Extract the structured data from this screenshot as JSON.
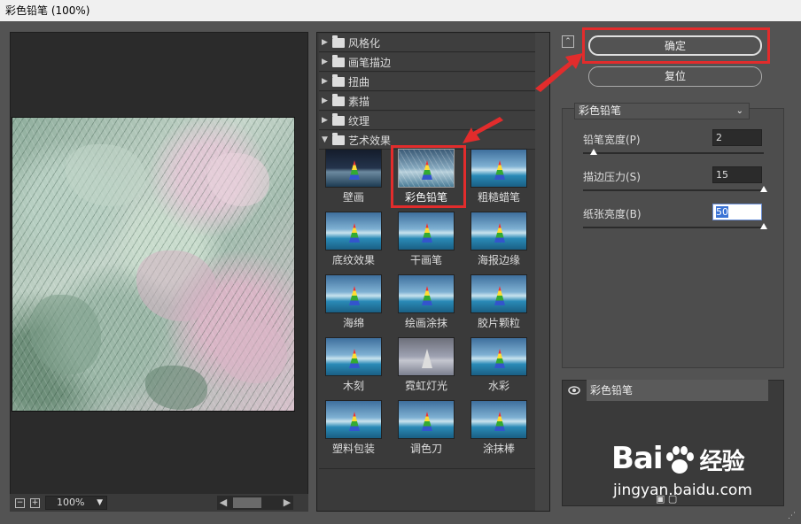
{
  "window": {
    "title": "彩色铅笔 (100%)"
  },
  "preview": {
    "zoom_value": "100%",
    "zoom_out_label": "−",
    "zoom_in_label": "+"
  },
  "gallery": {
    "categories": [
      {
        "name": "风格化",
        "expanded": false
      },
      {
        "name": "画笔描边",
        "expanded": false
      },
      {
        "name": "扭曲",
        "expanded": false
      },
      {
        "name": "素描",
        "expanded": false
      },
      {
        "name": "纹理",
        "expanded": false
      },
      {
        "name": "艺术效果",
        "expanded": true
      }
    ],
    "filters": [
      "壁画",
      "彩色铅笔",
      "粗糙蜡笔",
      "底纹效果",
      "干画笔",
      "海报边缘",
      "海绵",
      "绘画涂抹",
      "胶片颗粒",
      "木刻",
      "霓虹灯光",
      "水彩",
      "塑料包装",
      "调色刀",
      "涂抹棒"
    ],
    "selected_filter": "彩色铅笔"
  },
  "buttons": {
    "ok": "确定",
    "reset": "复位"
  },
  "filter_settings": {
    "selected": "彩色铅笔",
    "params": [
      {
        "label": "铅笔宽度(P)",
        "value": "2",
        "slider": 0.04
      },
      {
        "label": "描边压力(S)",
        "value": "15",
        "slider": 1.0
      },
      {
        "label": "纸张亮度(B)",
        "value": "50",
        "slider": 1.0
      }
    ]
  },
  "layers": {
    "items": [
      "彩色铅笔"
    ]
  },
  "watermark": {
    "brand": "Bai",
    "brand_cn": "经验",
    "url": "jingyan.baidu.com"
  },
  "colors": {
    "highlight": "#e22c2c",
    "panel": "#535353",
    "dark": "#2b2b2b"
  }
}
